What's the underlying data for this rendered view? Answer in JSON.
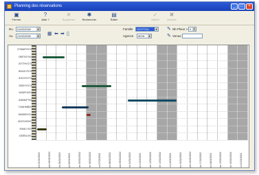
{
  "window": {
    "title": "Planning des réservations"
  },
  "toolbar": [
    {
      "label": "Fermer",
      "icon": "door-exit-icon",
      "glyph": "▣",
      "enabled": true
    },
    {
      "label": "Aide ?",
      "icon": "help-icon",
      "glyph": "?",
      "enabled": true
    },
    {
      "label": "Supprimer",
      "icon": "delete-icon",
      "glyph": "✕",
      "enabled": false
    },
    {
      "label": "Rechercher",
      "icon": "search-icon",
      "glyph": "✱",
      "enabled": true
    },
    {
      "label": "Éditer",
      "icon": "printer-icon",
      "glyph": "▤",
      "enabled": true
    },
    {
      "label": "Valider",
      "icon": "check-icon",
      "glyph": "✓",
      "enabled": false
    },
    {
      "label": "Annuler",
      "icon": "cancel-icon",
      "glyph": "✖",
      "enabled": false
    }
  ],
  "filters": {
    "du_label": "Du",
    "du_value": "01/02/2002",
    "au_label": "Au",
    "au_value": "21/02/2002",
    "famille_label": "Famille",
    "famille_value": "VOITTOU",
    "agence_label": "Agence",
    "agence_value": "MON",
    "nbplace_label": "Nb Place >=",
    "nbplace_value": "0",
    "venue_label": "Venue",
    "venue_value": ""
  },
  "rows": [
    "0708ARY974",
    "0987NTV01",
    "2077HVG74",
    "8094XYD74",
    "8101XXV74",
    "2083YXX74",
    "9426FHX01",
    "5460MFT03",
    "7136HMB01",
    "5460MSY01",
    "6222VWX01",
    "9064LYJ01",
    "1305NLX01"
  ],
  "columns": [
    "ven 01/02/2002",
    "sam 02/02/2002",
    "dim 03/02/2002",
    "lun 04/02/2002",
    "mar 05/02/2002",
    "mer 06/02/2002",
    "jeu 07/02/2002",
    "ven 08/02/2002",
    "sam 09/02/2002",
    "dim 10/02/2002",
    "lun 11/02/2002",
    "mar 12/02/2002",
    "mer 13/02/2002",
    "jeu 14/02/2002",
    "ven 15/02/2002",
    "sam 16/02/2002",
    "dim 17/02/2002",
    "lun 18/02/2002",
    "mar 19/02/2002",
    "mer 20/02/2002",
    "jeu 21/02/2002"
  ],
  "weekend_columns": [
    5,
    6,
    12,
    13,
    19,
    20
  ],
  "reservations": [
    {
      "row": 1,
      "start": 0.6,
      "end": 2.8,
      "color": "#1e5a3c"
    },
    {
      "row": 5,
      "start": 4.5,
      "end": 7.4,
      "color": "#1e5a3c"
    },
    {
      "row": 7,
      "start": 9.1,
      "end": 13.9,
      "color": "#0f4a62"
    },
    {
      "row": 8,
      "start": 2.5,
      "end": 5.2,
      "color": "#0f3a5a"
    },
    {
      "row": 9,
      "start": 5.0,
      "end": 5.4,
      "color": "#8a2a1a"
    },
    {
      "row": 11,
      "start": 0.1,
      "end": 1.0,
      "color": "#3a3a10"
    }
  ],
  "colors": {
    "titlebar": "#1941b8",
    "weekend": "#a7a7a7",
    "window_bg": "#f1efe2"
  }
}
